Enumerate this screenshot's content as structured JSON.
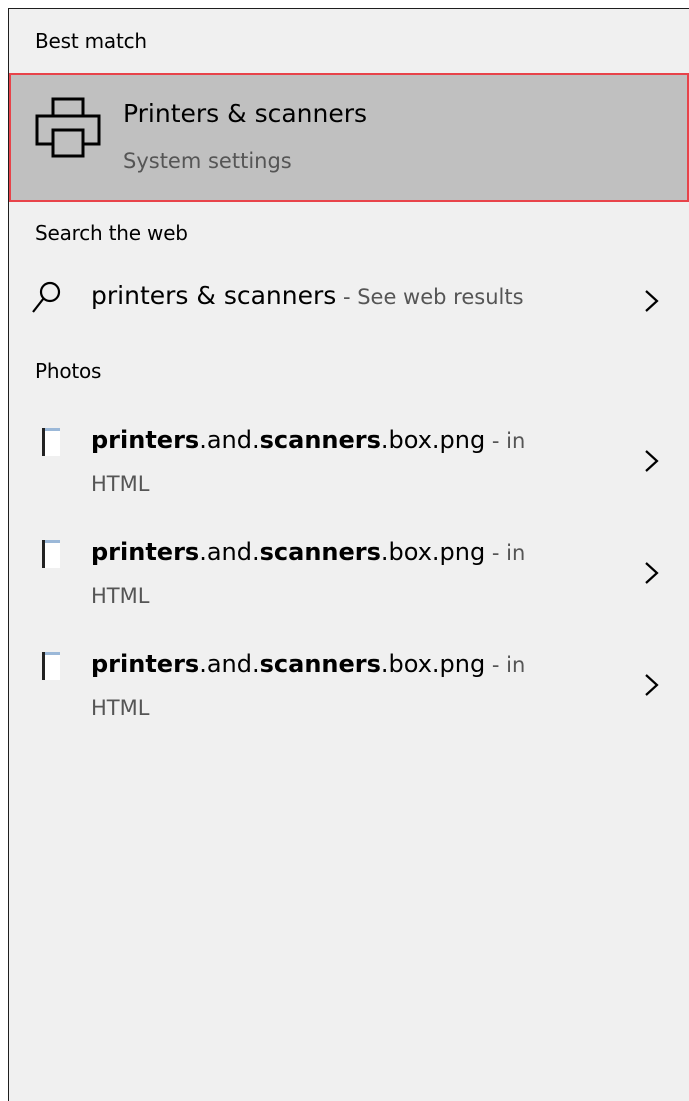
{
  "best_match": {
    "header": "Best match",
    "title": "Printers & scanners",
    "subtitle": "System settings",
    "icon": "printer-icon"
  },
  "web": {
    "header": "Search the web",
    "query": "printers & scanners",
    "hint": " - See web results",
    "icon": "search-icon"
  },
  "photos": {
    "header": "Photos",
    "items": [
      {
        "part1": "printers",
        "part2": ".and.",
        "part3": "scanners",
        "part4": ".box.png",
        "in_label": " - in",
        "location": "HTML"
      },
      {
        "part1": "printers",
        "part2": ".and.",
        "part3": "scanners",
        "part4": ".box.png",
        "in_label": " - in",
        "location": "HTML"
      },
      {
        "part1": "printers",
        "part2": ".and.",
        "part3": "scanners",
        "part4": ".box.png",
        "in_label": " - in",
        "location": "HTML"
      }
    ]
  },
  "colors": {
    "panel_bg": "#f0f0f0",
    "selected_bg": "#c0c0c0",
    "selected_border": "#e8434a",
    "secondary_text": "#555555"
  }
}
